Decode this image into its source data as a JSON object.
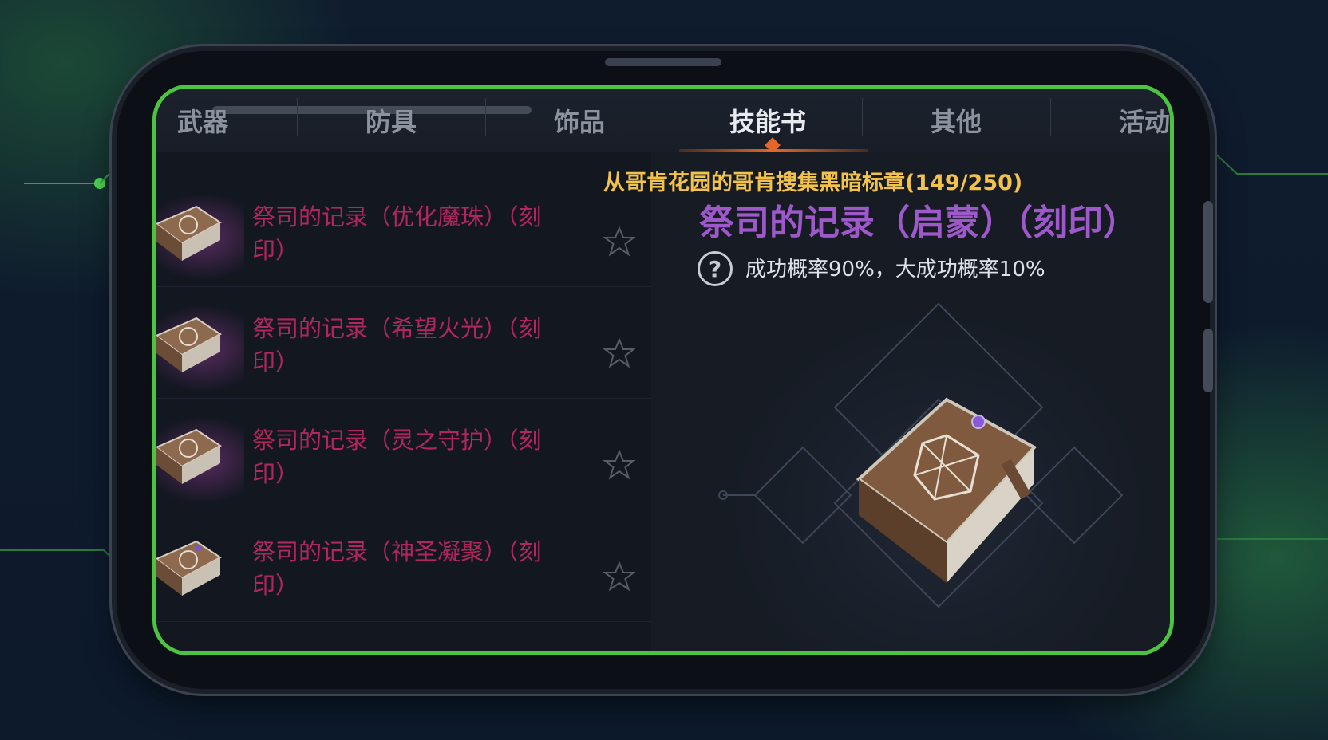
{
  "tabs": [
    {
      "label": "武器",
      "active": false
    },
    {
      "label": "防具",
      "active": false
    },
    {
      "label": "饰品",
      "active": false
    },
    {
      "label": "技能书",
      "active": true
    },
    {
      "label": "其他",
      "active": false
    },
    {
      "label": "活动",
      "active": false
    }
  ],
  "items": [
    {
      "name": "祭司的记录（优化魔珠）（刻印）",
      "icon": "book-icon",
      "star": "star-outline-icon"
    },
    {
      "name": "祭司的记录（希望火光）（刻印）",
      "icon": "book-icon",
      "star": "star-outline-icon"
    },
    {
      "name": "祭司的记录（灵之守护）（刻印）",
      "icon": "book-icon",
      "star": "star-outline-icon"
    },
    {
      "name": "祭司的记录（神圣凝聚）（刻印）",
      "icon": "book-icon",
      "star": "star-outline-icon"
    }
  ],
  "detail": {
    "source": "从哥肯花园的哥肯搜集黑暗标章(149/250)",
    "title": "祭司的记录（启蒙）（刻印）",
    "help_icon": "?",
    "rate": "成功概率90%，大成功概率10%"
  },
  "colors": {
    "frame_accent": "#4cc441",
    "item_name": "#b1275c",
    "title": "#9d58c9",
    "source": "#f2c24a",
    "tab_underline": "#e4672a"
  }
}
